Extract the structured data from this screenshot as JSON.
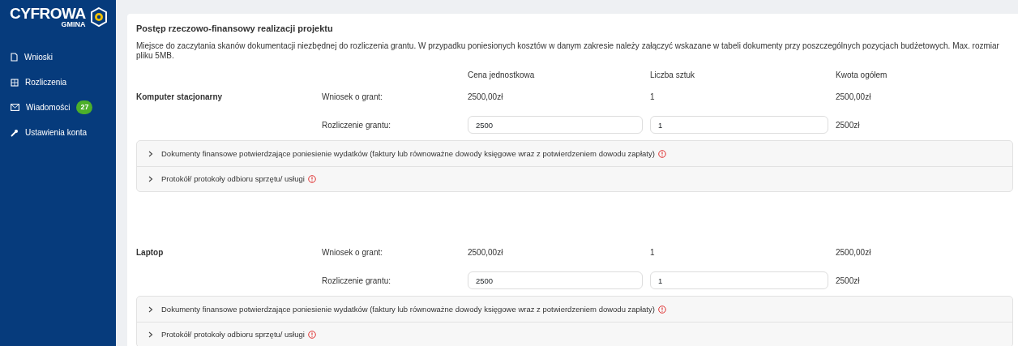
{
  "sidebar": {
    "logo": {
      "word": "CYFROWA",
      "subword": "GMINA"
    },
    "items": [
      {
        "label": "Wnioski"
      },
      {
        "label": "Rozliczenia"
      },
      {
        "label": "Wiadomości",
        "badge": "27"
      },
      {
        "label": "Ustawienia konta"
      }
    ]
  },
  "card": {
    "title": "Postęp rzeczowo-finansowy realizacji projektu",
    "description": "Miejsce do zaczytania skanów dokumentacji niezbędnej do rozliczenia grantu. W przypadku poniesionych kosztów w danym zakresie należy załączyć wskazane w tabeli dokumenty przy poszczególnych pozycjach budżetowych. Max. rozmiar pliku 5MB.",
    "columns": [
      "Cena jednostkowa",
      "Liczba sztuk",
      "Kwota ogółem"
    ],
    "items": [
      {
        "name": "Komputer stacjonarny",
        "request_label": "Wniosek o grant:",
        "request_price": "2500,00zł",
        "request_qty": "1",
        "request_total": "2500,00zł",
        "settle_label": "Rozliczenie grantu:",
        "settle_price": "2500",
        "settle_qty": "1",
        "settle_total": "2500zł",
        "documents": [
          {
            "label": "Dokumenty finansowe potwierdzające poniesienie wydatków (faktury lub równoważne dowody księgowe wraz z potwierdzeniem dowodu zapłaty)",
            "expanded": false
          },
          {
            "label": "Protokół/ protokoły odbioru sprzętu/ usługi",
            "expanded": false
          }
        ]
      },
      {
        "name": "Laptop",
        "request_label": "Wniosek o grant:",
        "request_price": "2500,00zł",
        "request_qty": "1",
        "request_total": "2500,00zł",
        "settle_label": "Rozliczenie grantu:",
        "settle_price": "2500",
        "settle_qty": "1",
        "settle_total": "2500zł",
        "documents": [
          {
            "label": "Dokumenty finansowe potwierdzające poniesienie wydatków (faktury lub równoważne dowody księgowe wraz z potwierdzeniem dowodu zapłaty)",
            "expanded": false
          },
          {
            "label": "Protokół/ protokoły odbioru sprzętu/ usługi",
            "expanded": false
          }
        ]
      }
    ]
  }
}
